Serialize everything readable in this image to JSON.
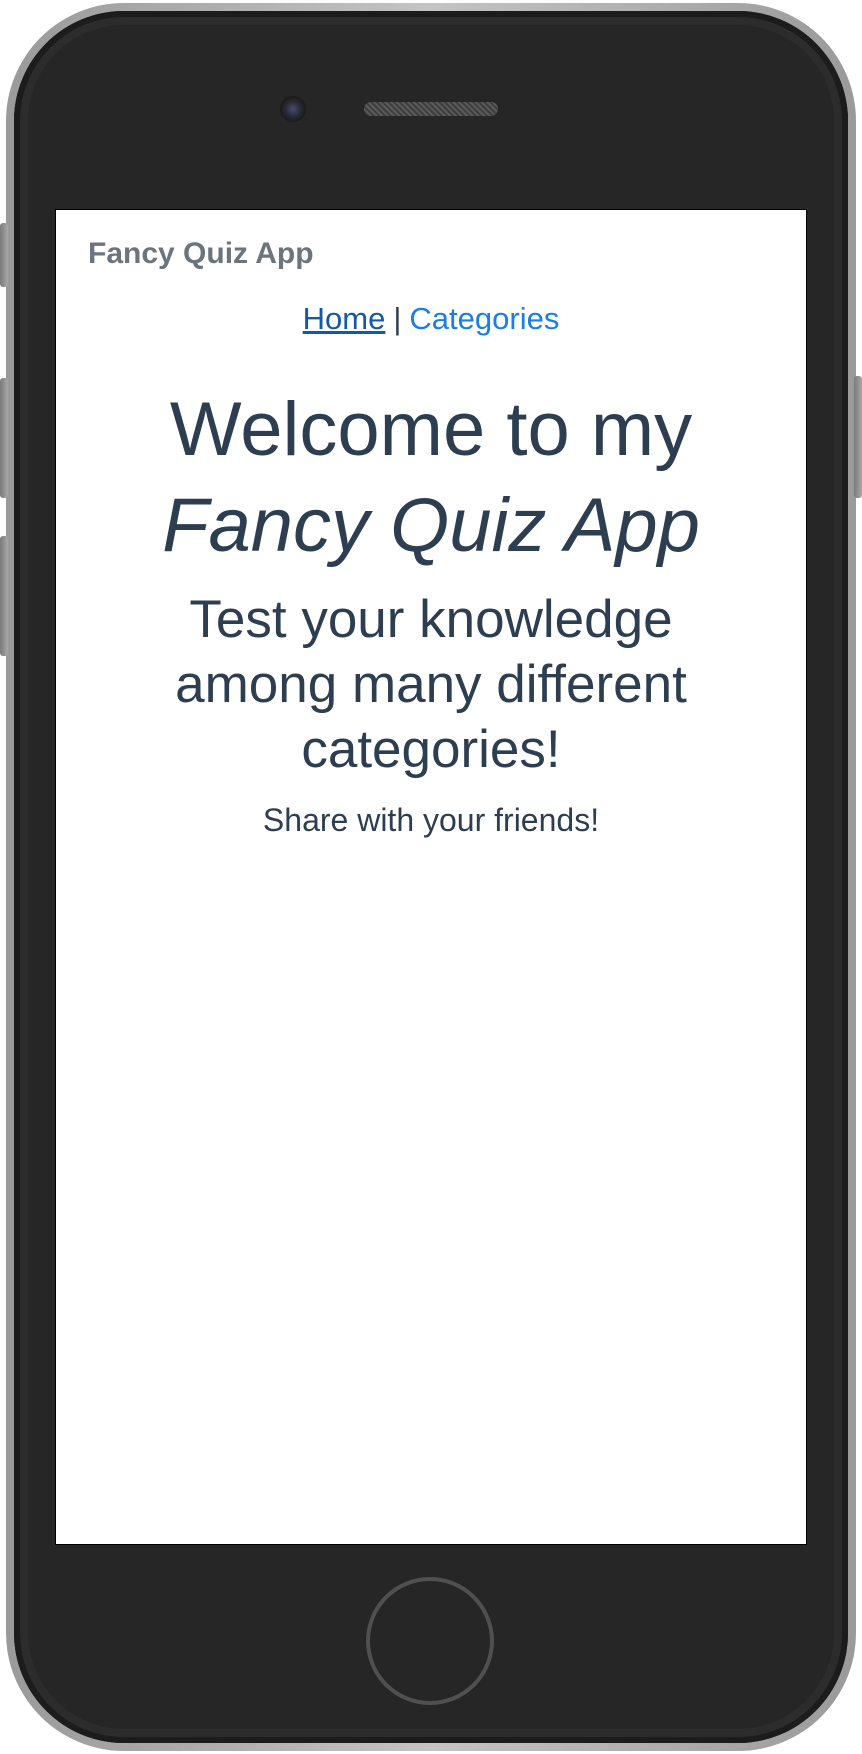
{
  "app": {
    "brand": "Fancy Quiz App"
  },
  "nav": {
    "home_label": "Home",
    "separator": "|",
    "categories_label": "Categories"
  },
  "hero": {
    "welcome_text": "Welcome to my",
    "app_name": "Fancy Quiz App"
  },
  "subtitle": "Test your knowledge among many different categories!",
  "share_text": "Share with your friends!",
  "colors": {
    "text": "#2c3e50",
    "brand": "#6c757d",
    "link": "#1a7ee6",
    "link_active": "#1458a8",
    "device": "#262626"
  }
}
